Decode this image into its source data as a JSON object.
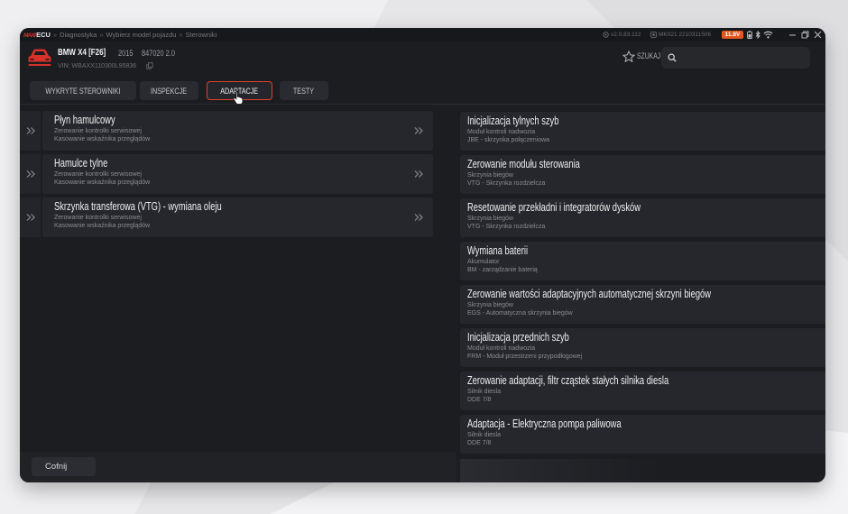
{
  "titlebar": {
    "logo": "MAXI",
    "breadcrumb": {
      "root": "ECU",
      "separator": "»",
      "items": [
        "Diagnostyka",
        "Wybierz model pojazdu",
        "Sterowniki"
      ]
    },
    "version_icon": "info-circle-icon",
    "version": "v2.0.83.112",
    "device_icon": "device-icon",
    "device_serial": "MK021 2210311506",
    "battery_voltage": "11.8V",
    "status_icons": [
      "battery-icon",
      "bluetooth-icon",
      "wifi-icon"
    ],
    "window_controls": [
      "minimize-icon",
      "restore-icon",
      "close-icon"
    ]
  },
  "vehicle": {
    "icon": "car-icon",
    "name": "BMW X4 [F26]",
    "year": "2015",
    "engine": "847020 2.0",
    "vin": "VIN: WBAXX110300L95836",
    "vin_copy_icon": "copy-icon"
  },
  "search": {
    "favorites_icon": "star-icon",
    "label": "SZUKAJ",
    "icon": "search-icon",
    "value": ""
  },
  "tabs": [
    {
      "label": "WYKRYTE STEROWNIKI",
      "active": false
    },
    {
      "label": "INSPEKCJE",
      "active": false
    },
    {
      "label": "ADAPTACJE",
      "active": true
    },
    {
      "label": "TESTY",
      "active": false
    }
  ],
  "cursor_icon": "hand-pointer-icon",
  "left_list": {
    "expand_icon": "double-chevron-right-icon",
    "items": [
      {
        "title": "Płyn hamulcowy",
        "lines": [
          "Zerowanie kontrolki serwisowej",
          "Kasowanie wskaźnika przeglądów"
        ]
      },
      {
        "title": "Hamulce tylne",
        "lines": [
          "Zerowanie kontrolki serwisowej",
          "Kasowanie wskaźnika przeglądów"
        ]
      },
      {
        "title": "Skrzynka transferowa (VTG) - wymiana oleju",
        "lines": [
          "Zerowanie kontrolki serwisowej",
          "Kasowanie wskaźnika przeglądów"
        ]
      }
    ]
  },
  "right_list": {
    "items": [
      {
        "title": "Inicjalizacja tylnych szyb",
        "lines": [
          "Moduł kontroli nadwozia",
          "JBE - skrzynka połączeniowa"
        ]
      },
      {
        "title": "Zerowanie modułu sterowania",
        "lines": [
          "Skrzynia biegów",
          "VTG - Skrzynka rozdzielcza"
        ]
      },
      {
        "title": "Resetowanie przekładni i integratorów dysków",
        "lines": [
          "Skrzynia biegów",
          "VTG - Skrzynka rozdzielcza"
        ]
      },
      {
        "title": "Wymiana baterii",
        "lines": [
          "Akumulator",
          "BM - zarządzanie baterią"
        ]
      },
      {
        "title": "Zerowanie wartości adaptacyjnych automatycznej skrzyni biegów",
        "lines": [
          "Skrzynia biegów",
          "EGS - Automatyczna skrzynia biegów"
        ]
      },
      {
        "title": "Inicjalizacja przednich szyb",
        "lines": [
          "Moduł kontroli nadwozia",
          "FRM - Moduł przestrzeni przypodłogowej"
        ]
      },
      {
        "title": "Zerowanie adaptacji, filtr cząstek stałych silnika diesla",
        "lines": [
          "Silnik diesla",
          "DDE 7/8"
        ]
      },
      {
        "title": "Adaptacja - Elektryczna pompa paliwowa",
        "lines": [
          "Silnik diesla",
          "DDE 7/8"
        ]
      }
    ]
  },
  "footer": {
    "back_label": "Cofnij"
  },
  "colors": {
    "window_background": "#1c1d21",
    "card_background": "#26272c",
    "accent": "#e0402a",
    "logo_red": "#d8312a",
    "voltage_badge": "#e2581c",
    "text_primary": "#f0f0f2",
    "text_secondary": "#8b8c91"
  }
}
